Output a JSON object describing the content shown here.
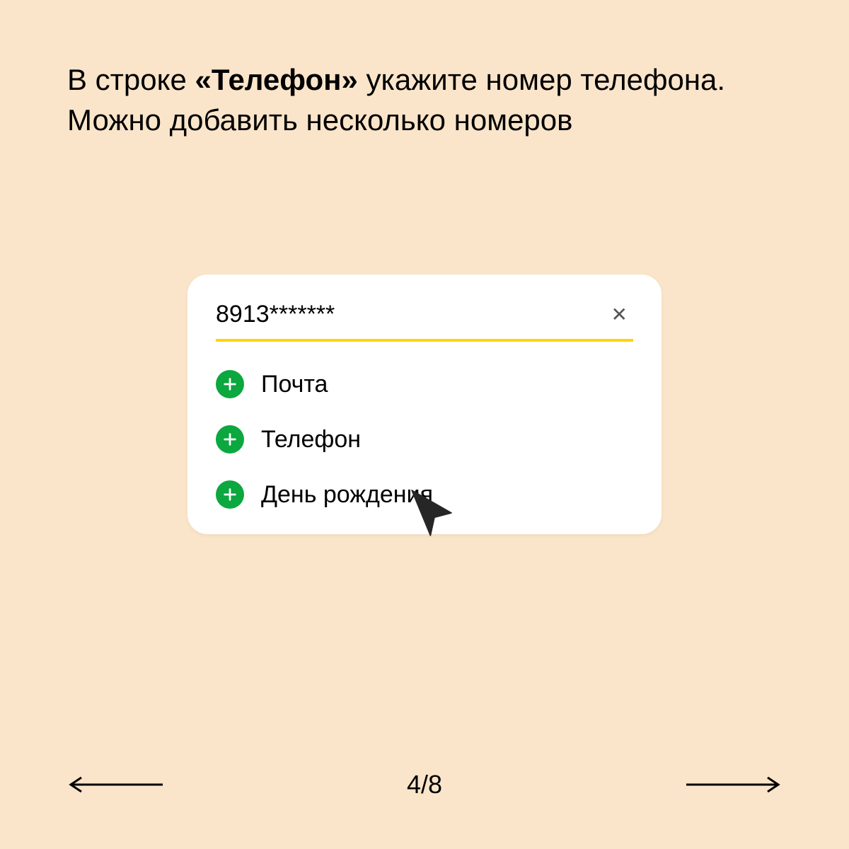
{
  "instruction": {
    "prefix": "В строке ",
    "bold": "«Телефон»",
    "rest": " укажите номер телефона. Можно добавить несколько номеров"
  },
  "card": {
    "input_value": "8913*******",
    "options": [
      {
        "label": "Почта"
      },
      {
        "label": "Телефон"
      },
      {
        "label": "День рождения"
      }
    ]
  },
  "pager": {
    "text": "4/8"
  }
}
